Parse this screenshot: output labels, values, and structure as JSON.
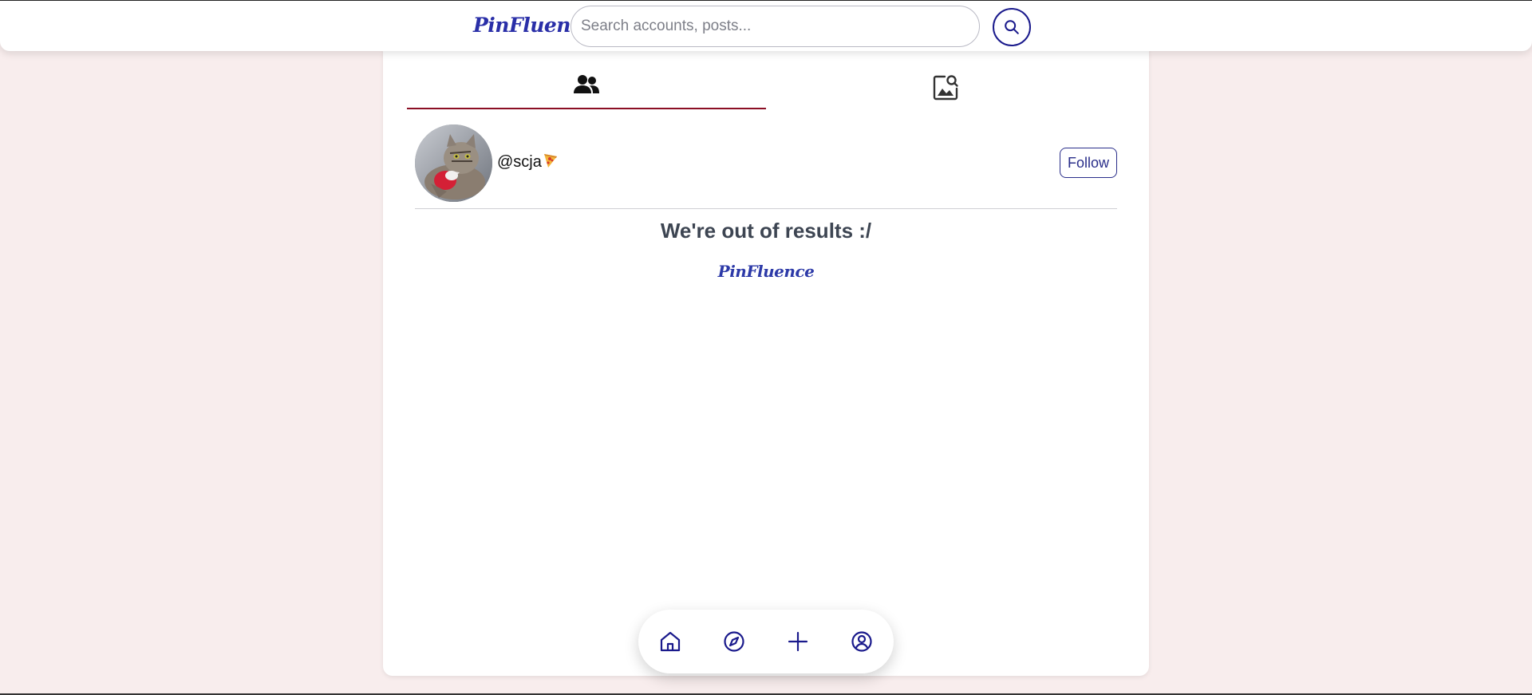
{
  "header": {
    "brand": "PinFluence",
    "search_placeholder": "Search accounts, posts...",
    "search_value": ""
  },
  "tabs": [
    {
      "name": "accounts",
      "icon": "people-icon",
      "active": true
    },
    {
      "name": "posts",
      "icon": "image-search-icon",
      "active": false
    }
  ],
  "results": [
    {
      "username": "@scja",
      "emoji": "pizza-icon",
      "avatar": "cat-photo",
      "follow_label": "Follow"
    }
  ],
  "end_message": "We're out of results :/",
  "footer_brand": "PinFluence",
  "bottom_nav": [
    {
      "name": "home",
      "icon": "home-icon"
    },
    {
      "name": "explore",
      "icon": "compass-icon"
    },
    {
      "name": "create",
      "icon": "plus-icon"
    },
    {
      "name": "profile",
      "icon": "user-circle-icon"
    }
  ],
  "colors": {
    "brand": "#2a2fa8",
    "accent_navy": "#1a1a8c",
    "active_tab_underline": "#8b0f25",
    "page_background": "#f8eded"
  }
}
